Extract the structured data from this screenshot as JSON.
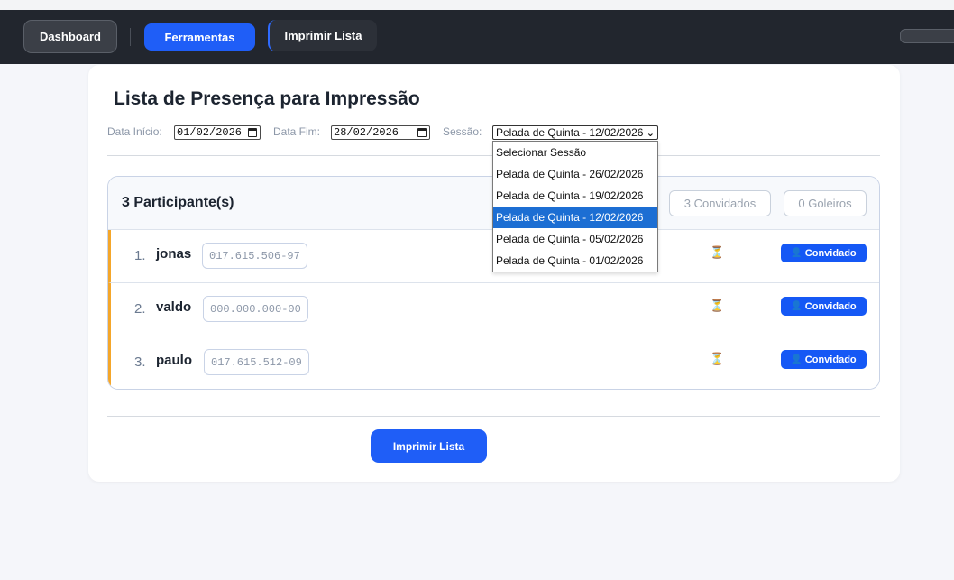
{
  "navbar": {
    "dashboard": "Dashboard",
    "ferramentas": "Ferramentas",
    "imprimir_lista": "Imprimir Lista"
  },
  "page": {
    "title": "Lista de Presença para Impressão"
  },
  "filters": {
    "data_inicio_label": "Data Início:",
    "data_inicio_value": "01/02/2026",
    "data_fim_label": "Data Fim:",
    "data_fim_value": "28/02/2026",
    "sessao_label": "Sessão:",
    "sessao_value": "Pelada de Quinta - 12/02/2026"
  },
  "session_dropdown": {
    "options": [
      "Selecionar Sessão",
      "Pelada de Quinta - 26/02/2026",
      "Pelada de Quinta - 19/02/2026",
      "Pelada de Quinta - 12/02/2026",
      "Pelada de Quinta - 05/02/2026",
      "Pelada de Quinta - 01/02/2026"
    ],
    "selected_index": 3
  },
  "participants": {
    "count_title": "3 Participante(s)",
    "convidados_pill": "3 Convidados",
    "goleiros_pill": "0 Goleiros",
    "rows": [
      {
        "num": "1.",
        "name": "jonas",
        "cpf": "017.615.506-97",
        "status_icon": "⏳",
        "badge": "Convidado",
        "badge_icon": "👤"
      },
      {
        "num": "2.",
        "name": "valdo",
        "cpf": "000.000.000-00",
        "status_icon": "⏳",
        "badge": "Convidado",
        "badge_icon": "👤"
      },
      {
        "num": "3.",
        "name": "paulo",
        "cpf": "017.615.512-09",
        "status_icon": "⏳",
        "badge": "Convidado",
        "badge_icon": "👤"
      }
    ]
  },
  "actions": {
    "print_button": "Imprimir Lista"
  },
  "colors": {
    "navbar_bg": "#22262e",
    "primary_blue": "#1f5ef7",
    "row_accent": "#f4a62a",
    "dropdown_selected": "#1c6ed3"
  }
}
